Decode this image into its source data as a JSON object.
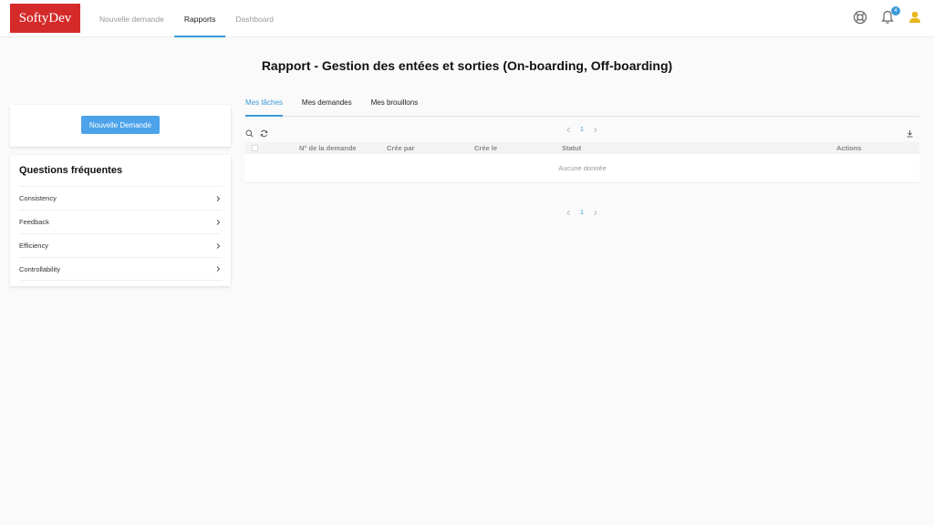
{
  "header": {
    "logo": "SoftyDev",
    "nav": [
      {
        "label": "Nouvelle demande",
        "active": false
      },
      {
        "label": "Rapports",
        "active": true
      },
      {
        "label": "Dashboard",
        "active": false
      }
    ],
    "notification_count": "4",
    "icons": [
      "support-icon",
      "bell-icon",
      "user-icon"
    ]
  },
  "page": {
    "title": "Rapport - Gestion des entées et sorties (On-boarding, Off-boarding)"
  },
  "sidebar": {
    "new_request_label": "Nouvelle Demande",
    "faq_title": "Questions fréquentes",
    "faq_items": [
      "Consistency",
      "Feedback",
      "Efficiency",
      "Controllability"
    ]
  },
  "main": {
    "tabs": [
      {
        "label": "Mes tâches",
        "active": true
      },
      {
        "label": "Mes demandes",
        "active": false
      },
      {
        "label": "Mes brouillons",
        "active": false
      }
    ],
    "pagination": {
      "current_page": "1"
    },
    "table": {
      "columns": [
        "N° de la demande",
        "Crée par",
        "Crée le",
        "Statut",
        "Actions"
      ],
      "empty_text": "Aucune donnée"
    }
  },
  "colors": {
    "brand_red": "#d42a2a",
    "accent_blue": "#3a9ad9",
    "button_blue": "#4da3e9",
    "user_icon": "#e8b71c"
  }
}
